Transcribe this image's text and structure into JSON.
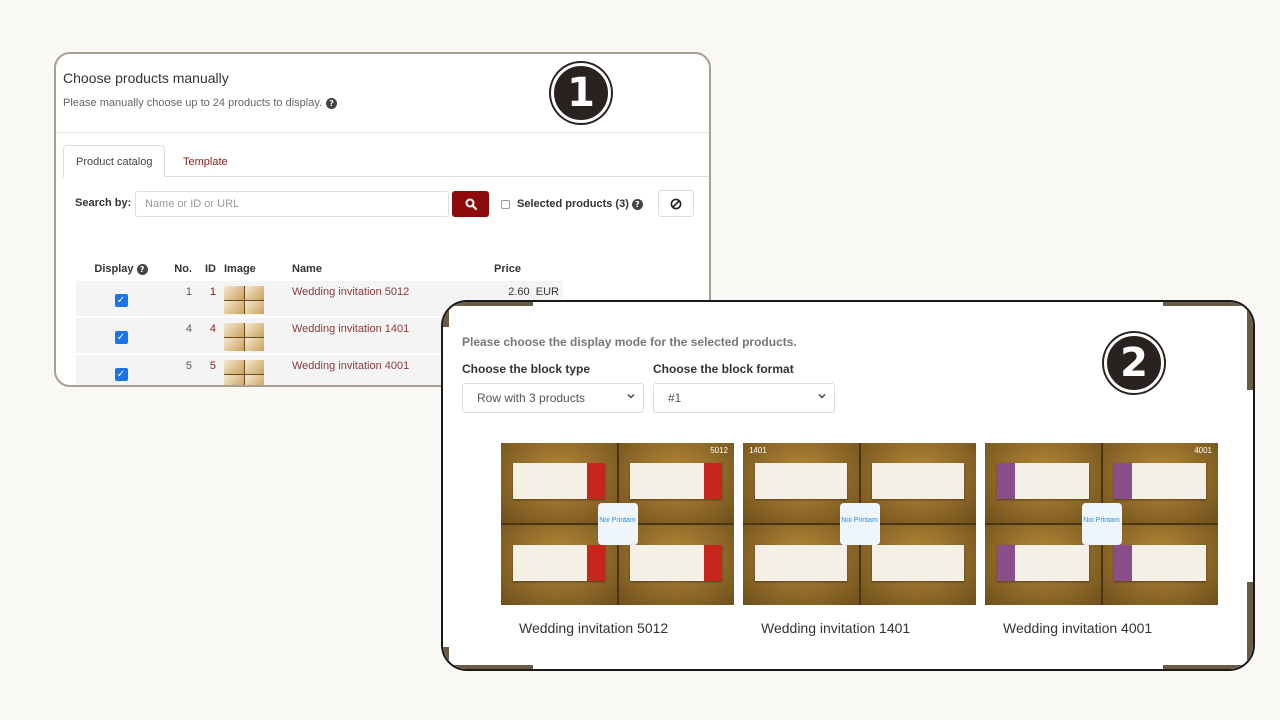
{
  "panel1": {
    "badge": "1",
    "title": "Choose products manually",
    "subtitle": "Please manually choose up to 24 products to display.",
    "tabs": [
      {
        "label": "Product catalog",
        "active": true
      },
      {
        "label": "Template",
        "active": false
      }
    ],
    "search": {
      "label": "Search by:",
      "placeholder": "Name or ID or URL",
      "value": ""
    },
    "selected_products_label": "Selected products (3)",
    "selected_products_checked": false,
    "table": {
      "headers": [
        "Display",
        "No.",
        "ID",
        "Image",
        "Name",
        "Price"
      ],
      "rows": [
        {
          "display": true,
          "no": "1",
          "id": "1",
          "name": "Wedding invitation 5012",
          "price": "2.60",
          "currency": "EUR"
        },
        {
          "display": true,
          "no": "4",
          "id": "4",
          "name": "Wedding invitation 1401",
          "price": "",
          "currency": ""
        },
        {
          "display": true,
          "no": "5",
          "id": "5",
          "name": "Wedding invitation 4001",
          "price": "",
          "currency": ""
        }
      ]
    },
    "icons": {
      "search": "search-icon",
      "clear": "ban-icon",
      "help": "question-circle-icon",
      "check": "checkmark-icon"
    }
  },
  "panel2": {
    "badge": "2",
    "intro": "Please choose the display mode for the selected products.",
    "block_type_label": "Choose the block type",
    "block_type_value": "Row with 3 products",
    "block_format_label": "Choose the block format",
    "block_format_value": "#1",
    "products": [
      {
        "title": "Wedding invitation 5012",
        "code": "5012",
        "logo": "Noi Printam"
      },
      {
        "title": "Wedding invitation 1401",
        "code": "1401",
        "logo": "Noi Printam"
      },
      {
        "title": "Wedding invitation 4001",
        "code": "4001",
        "logo": "Noi Printam"
      }
    ]
  },
  "colors": {
    "accent": "#8e0b0b",
    "link": "#8b1a1a",
    "checkbox": "#1a73e8",
    "frame": "#6b5a45",
    "badge": "#2a2220"
  }
}
